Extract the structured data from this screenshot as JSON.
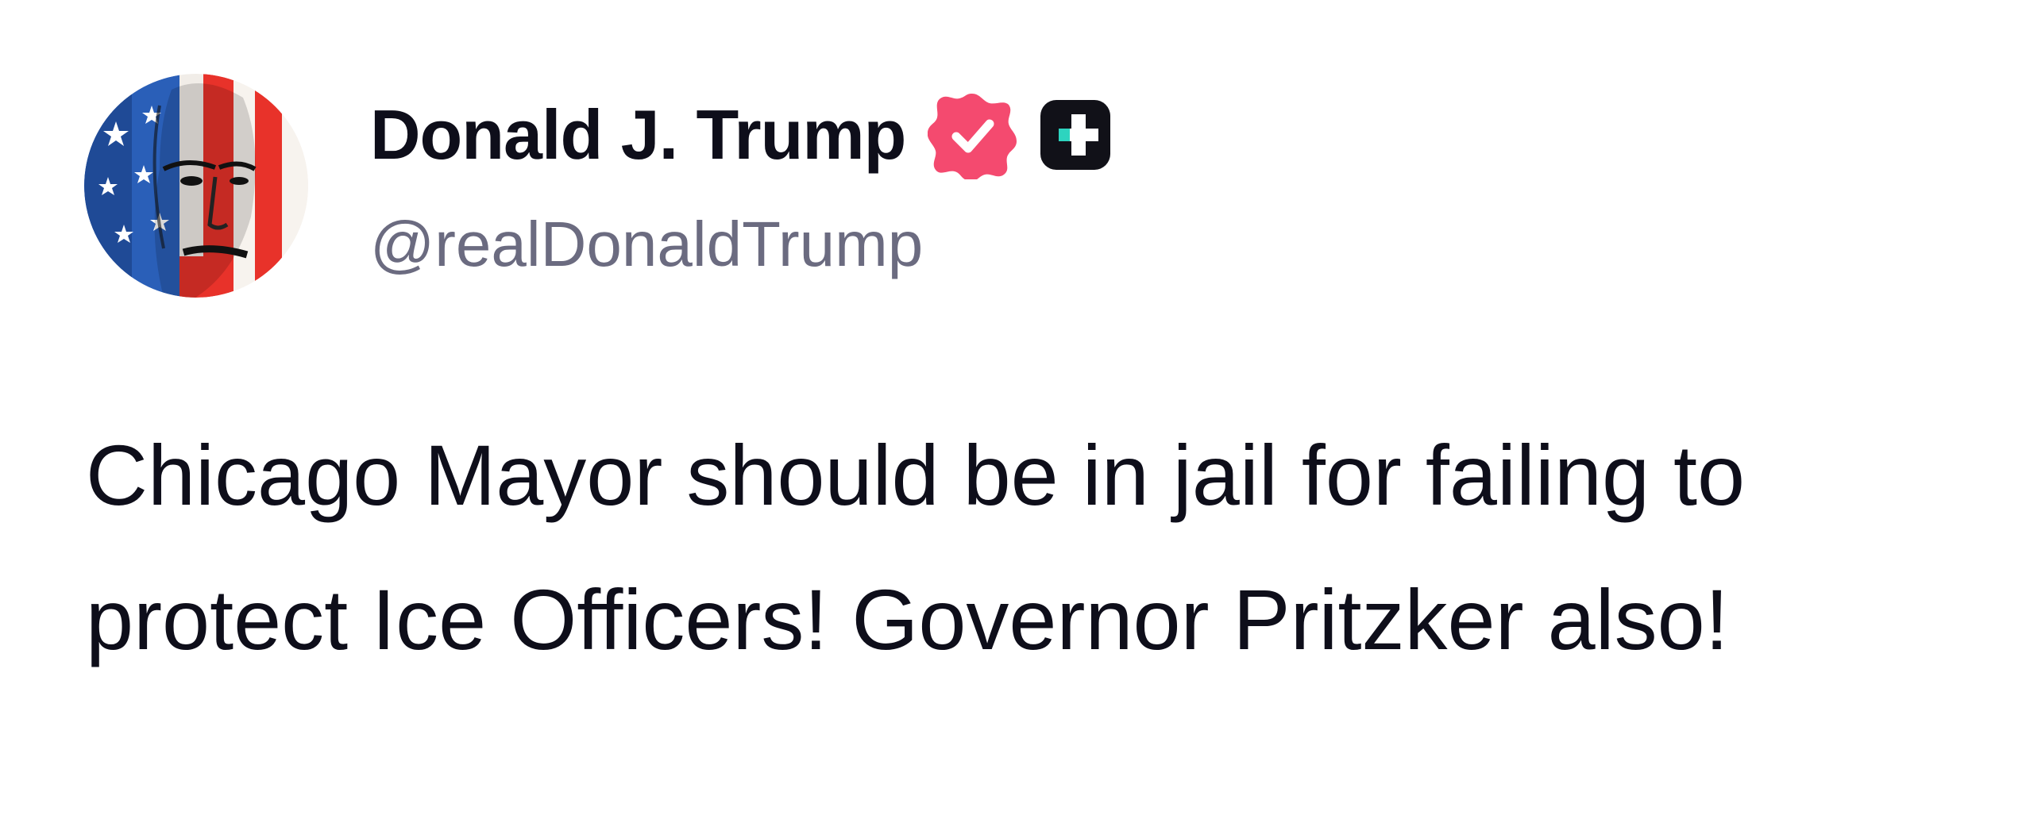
{
  "post": {
    "author": {
      "display_name": "Donald J. Trump",
      "handle": "@realDonaldTrump",
      "verified_icon": "verified-badge-icon",
      "plus_icon": "plus-badge-icon",
      "verified_color": "#f44a6f",
      "plus_color": "#111118",
      "plus_accent": "#2dd4bf"
    },
    "text": "Chicago Mayor should be in jail for failing to protect Ice Officers! Governor Pritzker also!"
  }
}
